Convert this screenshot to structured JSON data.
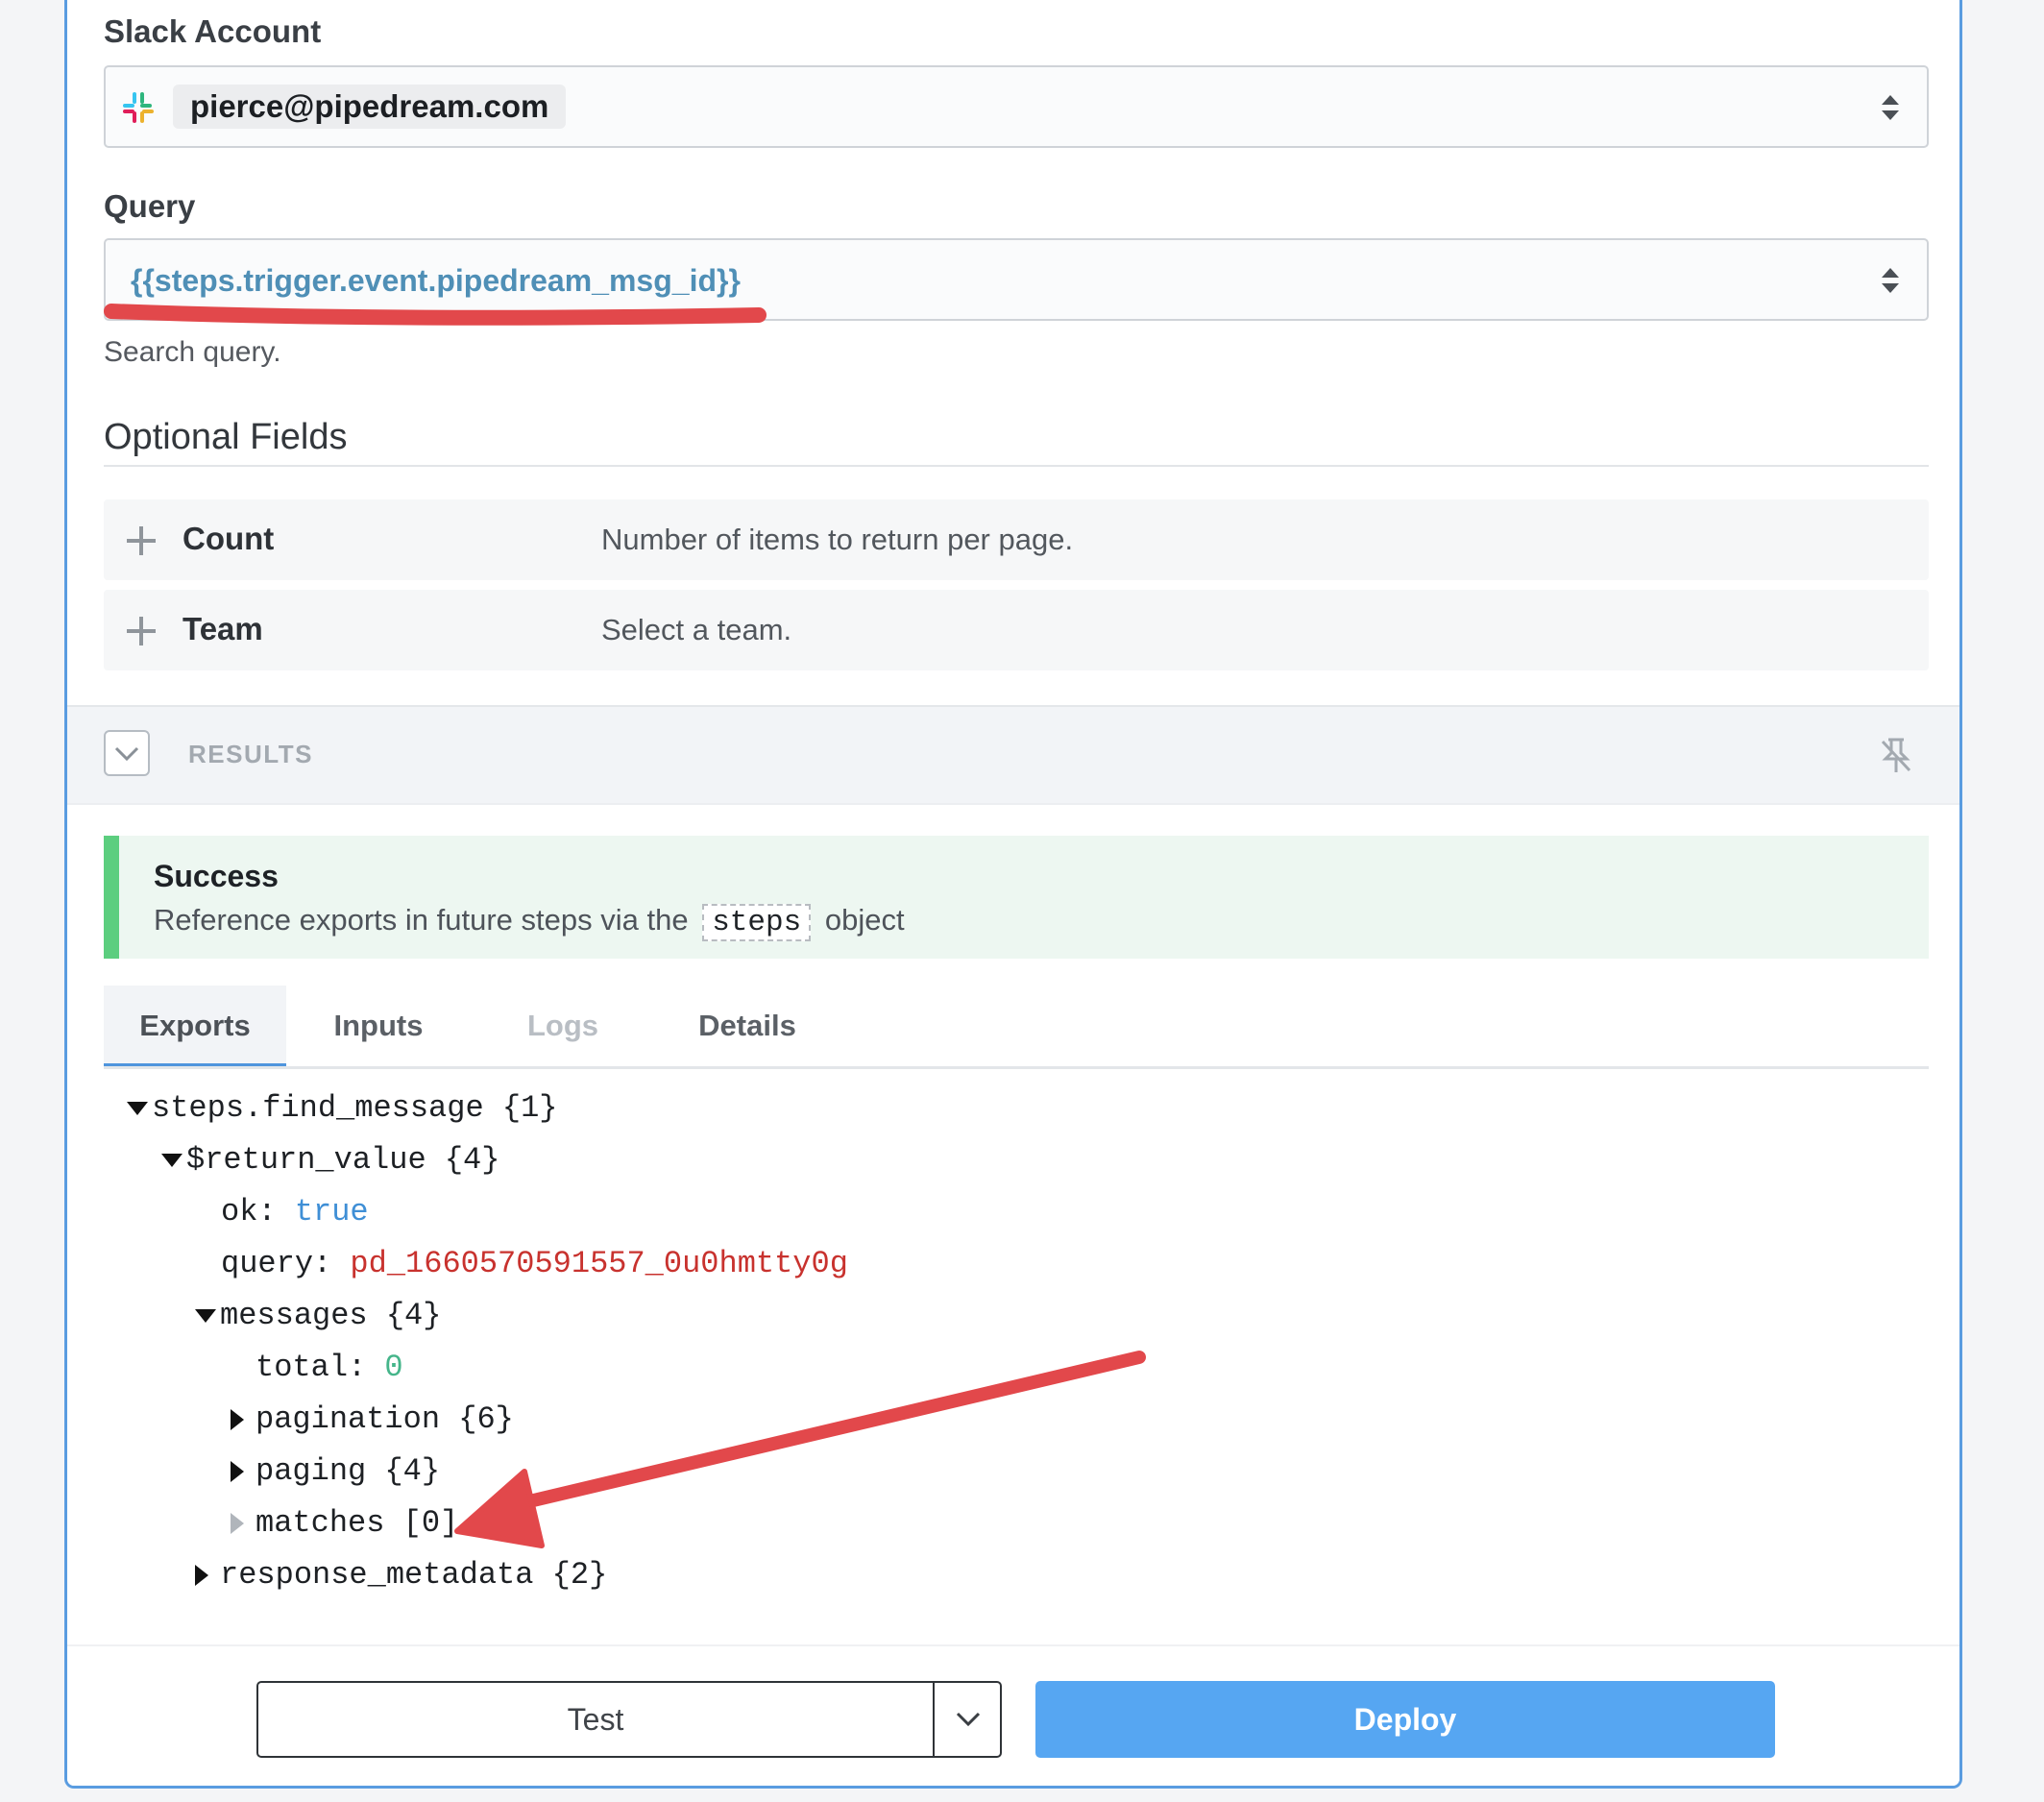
{
  "slack_account": {
    "label": "Slack Account",
    "value": "pierce@pipedream.com"
  },
  "query": {
    "label": "Query",
    "value": "{{steps.trigger.event.pipedream_msg_id}}",
    "hint": "Search query."
  },
  "optional_fields": {
    "title": "Optional Fields",
    "items": [
      {
        "name": "Count",
        "description": "Number of items to return per page."
      },
      {
        "name": "Team",
        "description": "Select a team."
      }
    ]
  },
  "results": {
    "label": "RESULTS"
  },
  "success": {
    "title": "Success",
    "message_before": "Reference exports in future steps via the",
    "code": "steps",
    "message_after": "object"
  },
  "tabs": [
    "Exports",
    "Inputs",
    "Logs",
    "Details"
  ],
  "tree": {
    "root": "steps.find_message {1}",
    "return_value": "$return_value {4}",
    "ok_key": "ok:",
    "ok_value": "true",
    "query_key": "query:",
    "query_value": "pd_1660570591557_0u0hmtty0g",
    "messages": "messages {4}",
    "total_key": "total:",
    "total_value": "0",
    "pagination": "pagination {6}",
    "paging": "paging {4}",
    "matches": "matches [0]",
    "response_metadata": "response_metadata {2}"
  },
  "footer": {
    "test_label": "Test",
    "deploy_label": "Deploy"
  },
  "colors": {
    "accent": "#56a6f2",
    "success": "#5cce7f",
    "annotation": "#e2484b"
  }
}
